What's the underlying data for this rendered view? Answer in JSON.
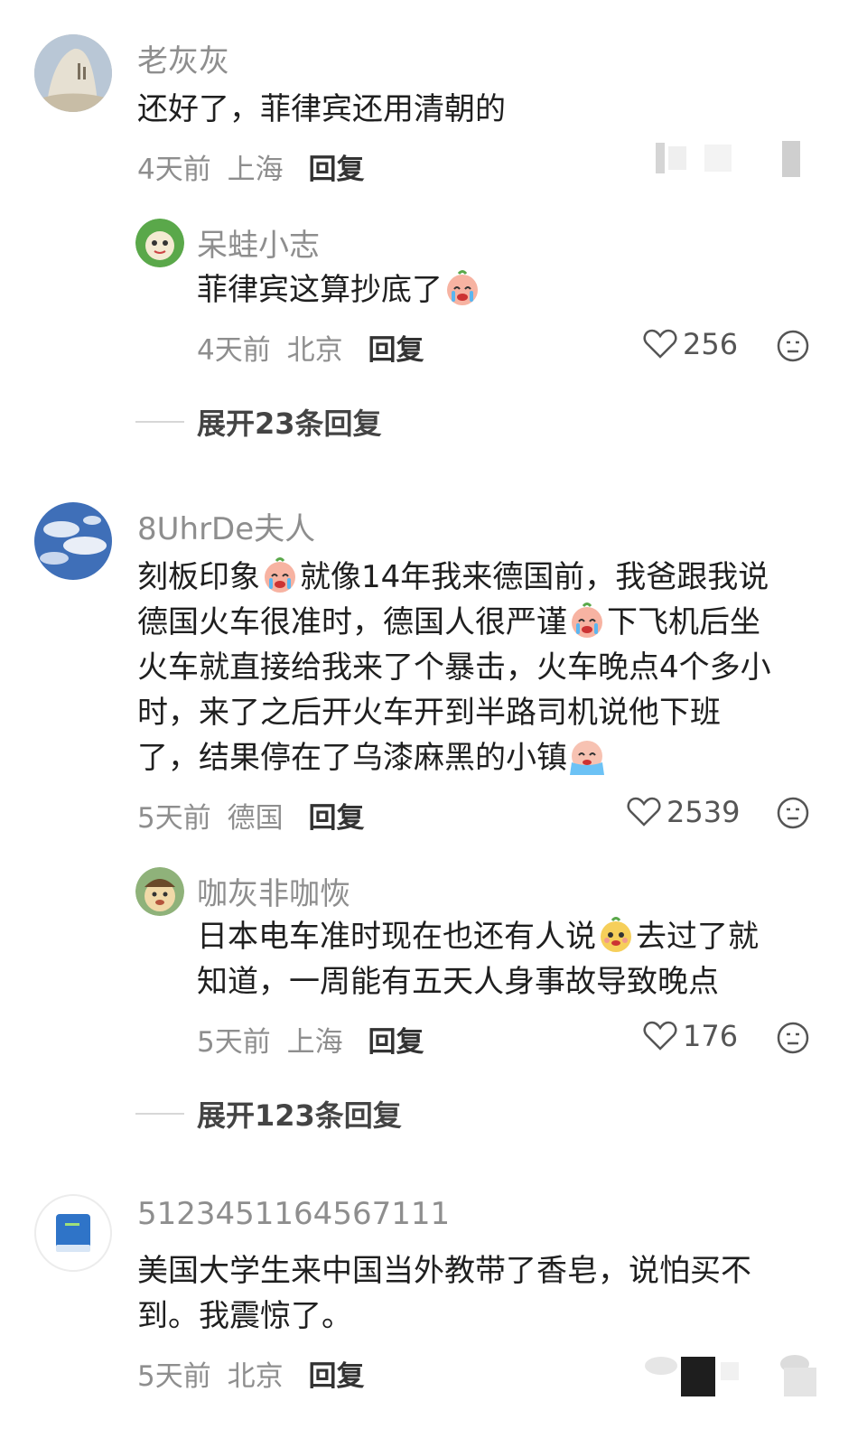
{
  "comments": [
    {
      "username": "老灰灰",
      "avatar": "rock-avatar",
      "lines": [
        "还好了，菲律宾还用清朝的"
      ],
      "time": "4天前",
      "location": "上海",
      "reply_label": "回复",
      "replies": [
        {
          "username": "呆蛙小志",
          "avatar": "frog-avatar",
          "line1_text": "菲律宾这算抄底了",
          "line1_emoji": "crying-face-emoji",
          "time": "4天前",
          "location": "北京",
          "reply_label": "回复",
          "likes": "256"
        }
      ],
      "expand_label": "展开23条回复"
    },
    {
      "username": "8UhrDe夫人",
      "avatar": "sky-avatar",
      "line1_a": "刻板印象",
      "line1_b": "就像14年我来德国前，我爸跟我说",
      "line2_a": "德国火车很准时，德国人很严谨",
      "line2_b": "下飞机后坐",
      "line3": "火车就直接给我来了个暴击，火车晚点4个多小",
      "line4": "时，来了之后开火车开到半路司机说他下班",
      "line5": "了，结果停在了乌漆麻黑的小镇",
      "time": "5天前",
      "location": "德国",
      "reply_label": "回复",
      "likes": "2539",
      "replies": [
        {
          "username": "咖灰非咖恢",
          "avatar": "cartoon-avatar",
          "line1_a": "日本电车准时现在也还有人说",
          "line1_b": "去过了就",
          "line2": "知道，一周能有五天人身事故导致晚点",
          "time": "5天前",
          "location": "上海",
          "reply_label": "回复",
          "likes": "176"
        }
      ],
      "expand_label": "展开123条回复"
    },
    {
      "username": "5123451164567111",
      "avatar": "book-avatar",
      "line1": "美国大学生来中国当外教带了香皂，说怕买不",
      "line2": "到。我震惊了。",
      "time": "5天前",
      "location": "北京",
      "reply_label": "回复"
    }
  ],
  "colors": {
    "username": "#8e8e8e",
    "text": "#1f1f1f",
    "meta": "#8e8e8e",
    "divider": "#d7d7d7"
  }
}
